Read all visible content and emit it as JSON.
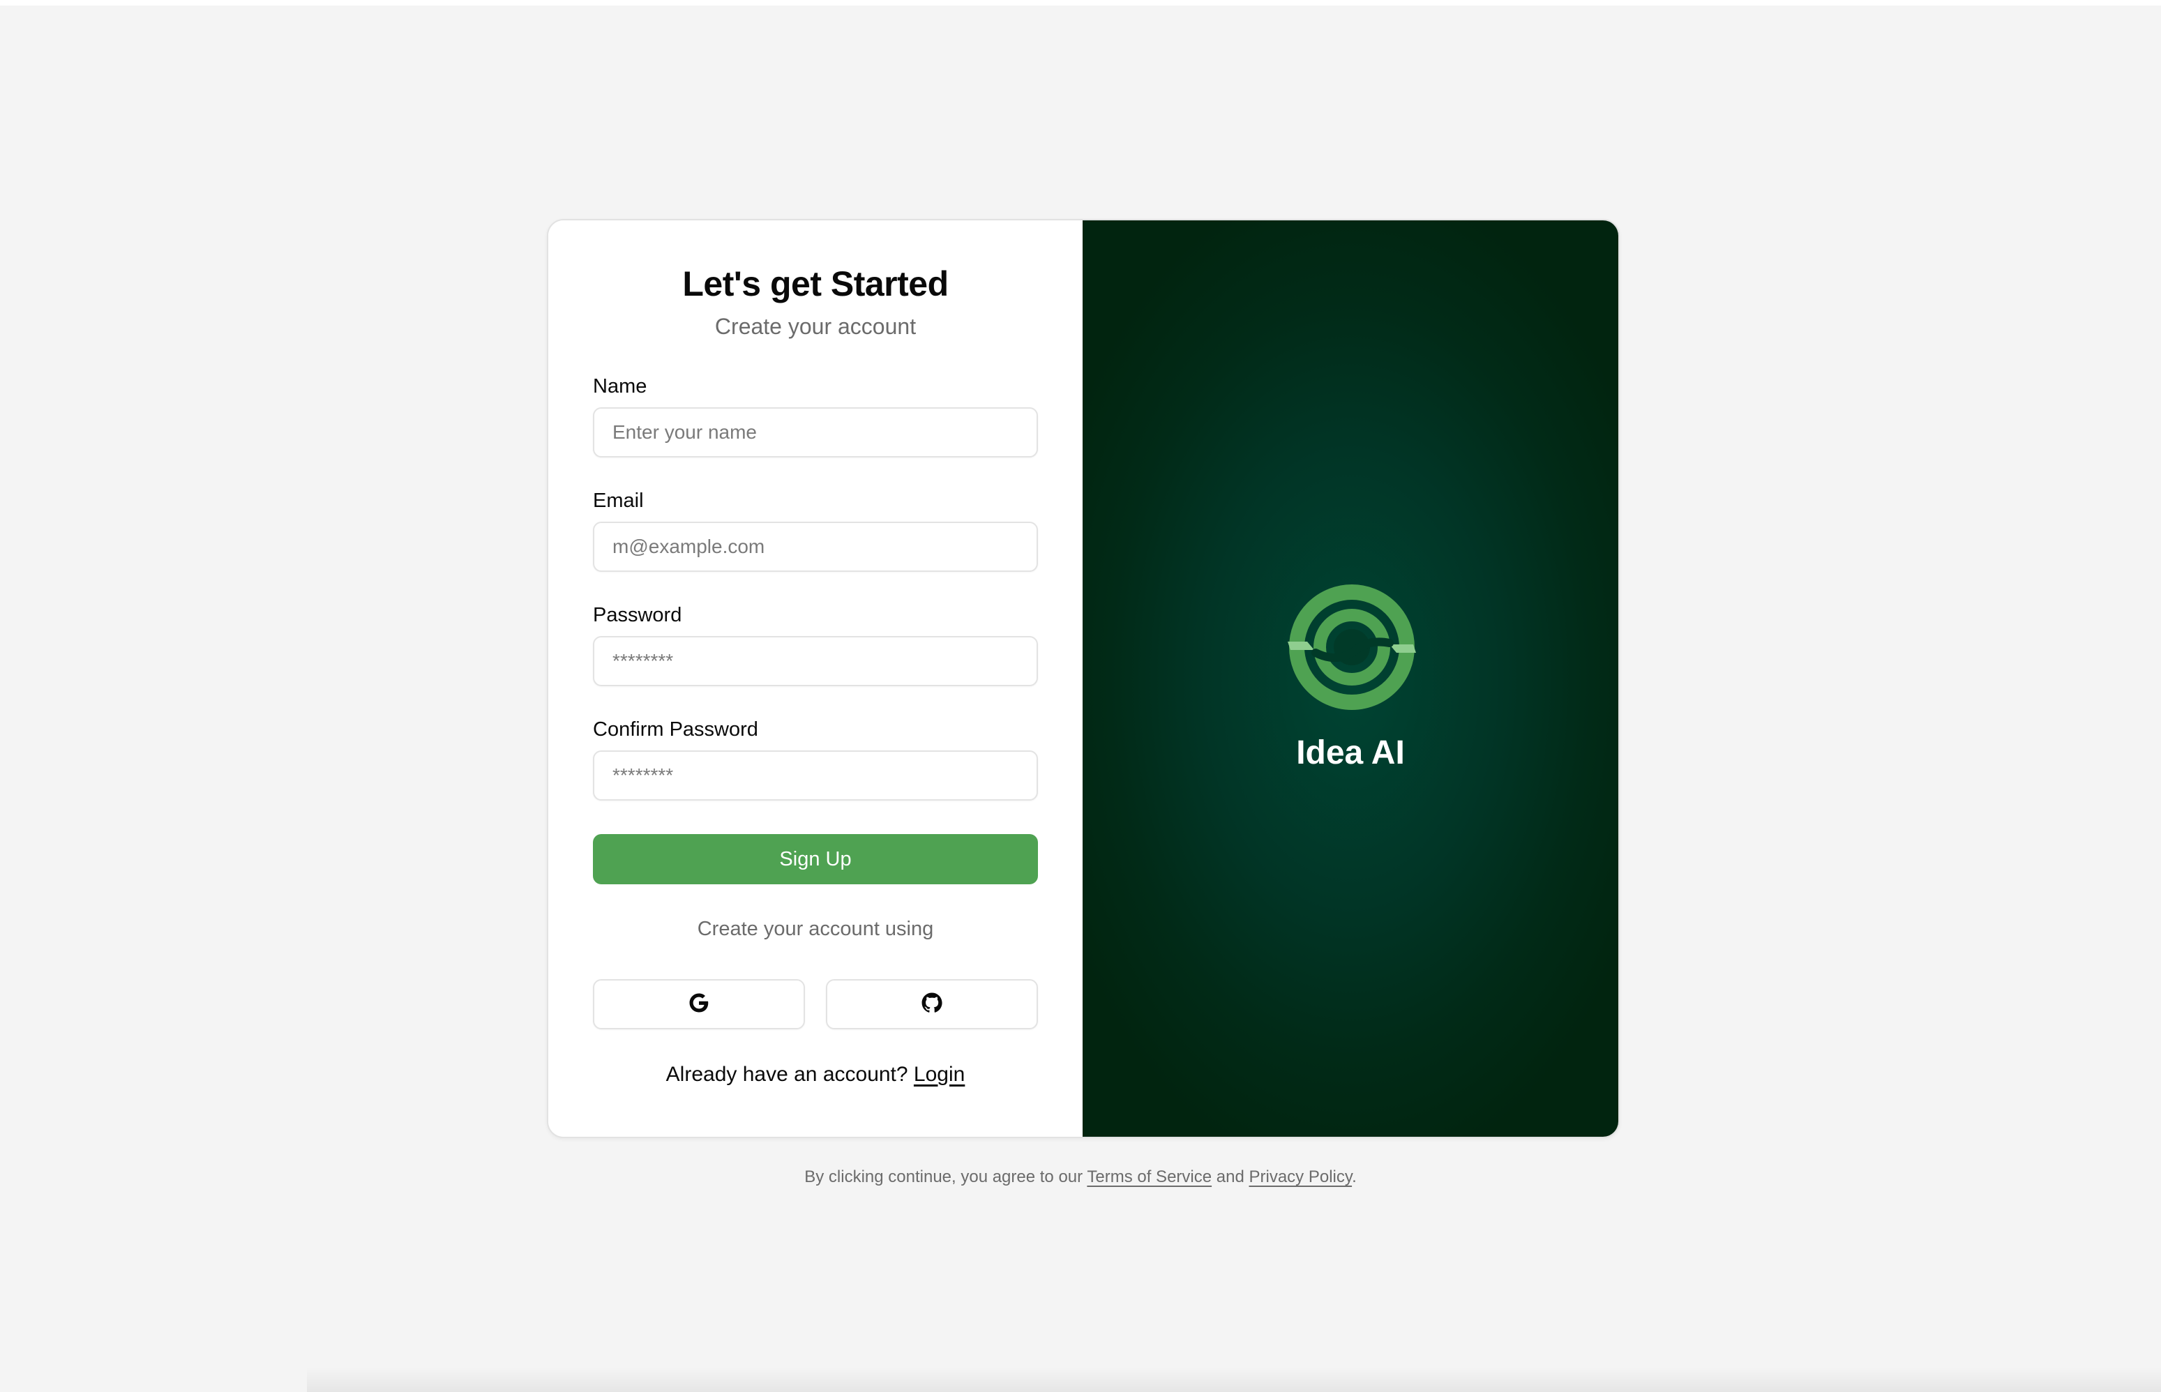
{
  "form": {
    "title": "Let's get Started",
    "subtitle": "Create your account",
    "name": {
      "label": "Name",
      "placeholder": "Enter your name",
      "value": ""
    },
    "email": {
      "label": "Email",
      "placeholder": "m@example.com",
      "value": ""
    },
    "password": {
      "label": "Password",
      "placeholder": "********",
      "value": ""
    },
    "confirm_password": {
      "label": "Confirm Password",
      "placeholder": "********",
      "value": ""
    },
    "submit_label": "Sign Up",
    "oauth_text": "Create your account using",
    "oauth_providers": [
      {
        "name": "google",
        "icon": "google-icon"
      },
      {
        "name": "github",
        "icon": "github-icon"
      }
    ],
    "login_prompt": "Already have an account?",
    "login_link": "Login"
  },
  "brand": {
    "name": "Idea AI",
    "logo_icon": "idea-ai-logo-icon"
  },
  "legal": {
    "prefix": "By clicking continue, you agree to our",
    "terms_link": "Terms of Service",
    "conjunction": "and",
    "privacy_link": "Privacy Policy",
    "suffix": "."
  },
  "colors": {
    "page_background": "#f4f4f4",
    "accent": "#4fa252",
    "brand_panel": "#013526",
    "logo_green": "#4fa252",
    "logo_highlight": "#8fce8f"
  }
}
